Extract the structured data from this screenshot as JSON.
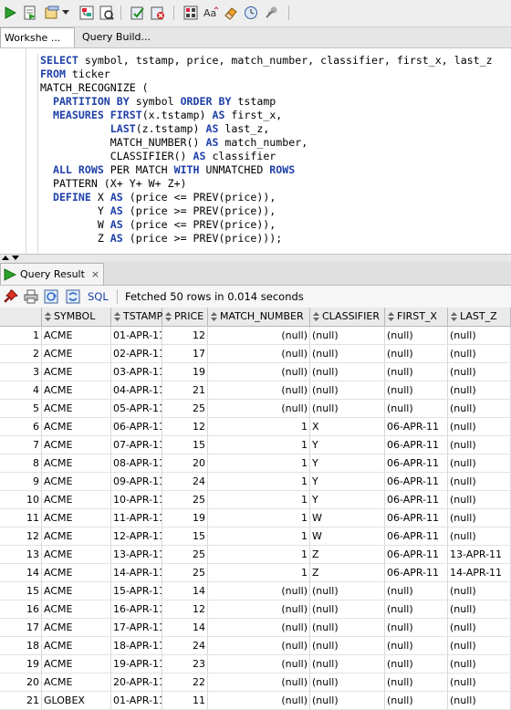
{
  "toolbar": {
    "buttons": [
      "run-statement",
      "run-script",
      "autotrace",
      "explain-plan",
      "sql-tuning",
      "commit",
      "rollback",
      "unshared-sql",
      "to-upper",
      "clear",
      "history",
      "sql-monitor"
    ]
  },
  "worksheet_tabs": [
    {
      "label": "Workshe ..."
    },
    {
      "label": "Query Build..."
    }
  ],
  "editor": {
    "lines": [
      [
        {
          "t": "SELECT",
          "k": 1
        },
        {
          "t": " symbol, tstamp, price, match_number, classifier, first_x, last_z",
          "k": 0
        }
      ],
      [
        {
          "t": "FROM",
          "k": 1
        },
        {
          "t": " ticker",
          "k": 0
        }
      ],
      [
        {
          "t": "MATCH_RECOGNIZE (",
          "k": 0
        }
      ],
      [
        {
          "t": "  ",
          "k": 0
        },
        {
          "t": "PARTITION BY",
          "k": 1
        },
        {
          "t": " symbol ",
          "k": 0
        },
        {
          "t": "ORDER BY",
          "k": 1
        },
        {
          "t": " tstamp",
          "k": 0
        }
      ],
      [
        {
          "t": "  ",
          "k": 0
        },
        {
          "t": "MEASURES FIRST",
          "k": 1
        },
        {
          "t": "(x.tstamp) ",
          "k": 0
        },
        {
          "t": "AS",
          "k": 1
        },
        {
          "t": " first_x,",
          "k": 0
        }
      ],
      [
        {
          "t": "           ",
          "k": 0
        },
        {
          "t": "LAST",
          "k": 1
        },
        {
          "t": "(z.tstamp) ",
          "k": 0
        },
        {
          "t": "AS",
          "k": 1
        },
        {
          "t": " last_z,",
          "k": 0
        }
      ],
      [
        {
          "t": "           MATCH_NUMBER() ",
          "k": 0
        },
        {
          "t": "AS",
          "k": 1
        },
        {
          "t": " match_number,",
          "k": 0
        }
      ],
      [
        {
          "t": "           CLASSIFIER() ",
          "k": 0
        },
        {
          "t": "AS",
          "k": 1
        },
        {
          "t": " classifier",
          "k": 0
        }
      ],
      [
        {
          "t": "  ",
          "k": 0
        },
        {
          "t": "ALL ROWS",
          "k": 1
        },
        {
          "t": " PER MATCH ",
          "k": 0
        },
        {
          "t": "WITH",
          "k": 1
        },
        {
          "t": " UNMATCHED ",
          "k": 0
        },
        {
          "t": "ROWS",
          "k": 1
        }
      ],
      [
        {
          "t": "  PATTERN (X+ Y+ W+ Z+)",
          "k": 0
        }
      ],
      [
        {
          "t": "  ",
          "k": 0
        },
        {
          "t": "DEFINE",
          "k": 1
        },
        {
          "t": " X ",
          "k": 0
        },
        {
          "t": "AS",
          "k": 1
        },
        {
          "t": " (price <= PREV(price)),",
          "k": 0
        }
      ],
      [
        {
          "t": "         Y ",
          "k": 0
        },
        {
          "t": "AS",
          "k": 1
        },
        {
          "t": " (price >= PREV(price)),",
          "k": 0
        }
      ],
      [
        {
          "t": "         W ",
          "k": 0
        },
        {
          "t": "AS",
          "k": 1
        },
        {
          "t": " (price <= PREV(price)),",
          "k": 0
        }
      ],
      [
        {
          "t": "         Z ",
          "k": 0
        },
        {
          "t": "AS",
          "k": 1
        },
        {
          "t": " (price >= PREV(price)));",
          "k": 0
        }
      ]
    ]
  },
  "result_tab": {
    "label": "Query Result",
    "close": "×"
  },
  "result_toolbar": {
    "sql_label": "SQL",
    "status": "Fetched 50 rows in 0.014 seconds"
  },
  "grid": {
    "columns": [
      "SYMBOL",
      "TSTAMP",
      "PRICE",
      "MATCH_NUMBER",
      "CLASSIFIER",
      "FIRST_X",
      "LAST_Z"
    ],
    "rows": [
      [
        "1",
        "ACME",
        "01-APR-11",
        "12",
        "(null)",
        "(null)",
        "(null)",
        "(null)"
      ],
      [
        "2",
        "ACME",
        "02-APR-11",
        "17",
        "(null)",
        "(null)",
        "(null)",
        "(null)"
      ],
      [
        "3",
        "ACME",
        "03-APR-11",
        "19",
        "(null)",
        "(null)",
        "(null)",
        "(null)"
      ],
      [
        "4",
        "ACME",
        "04-APR-11",
        "21",
        "(null)",
        "(null)",
        "(null)",
        "(null)"
      ],
      [
        "5",
        "ACME",
        "05-APR-11",
        "25",
        "(null)",
        "(null)",
        "(null)",
        "(null)"
      ],
      [
        "6",
        "ACME",
        "06-APR-11",
        "12",
        "1",
        "X",
        "06-APR-11",
        "(null)"
      ],
      [
        "7",
        "ACME",
        "07-APR-11",
        "15",
        "1",
        "Y",
        "06-APR-11",
        "(null)"
      ],
      [
        "8",
        "ACME",
        "08-APR-11",
        "20",
        "1",
        "Y",
        "06-APR-11",
        "(null)"
      ],
      [
        "9",
        "ACME",
        "09-APR-11",
        "24",
        "1",
        "Y",
        "06-APR-11",
        "(null)"
      ],
      [
        "10",
        "ACME",
        "10-APR-11",
        "25",
        "1",
        "Y",
        "06-APR-11",
        "(null)"
      ],
      [
        "11",
        "ACME",
        "11-APR-11",
        "19",
        "1",
        "W",
        "06-APR-11",
        "(null)"
      ],
      [
        "12",
        "ACME",
        "12-APR-11",
        "15",
        "1",
        "W",
        "06-APR-11",
        "(null)"
      ],
      [
        "13",
        "ACME",
        "13-APR-11",
        "25",
        "1",
        "Z",
        "06-APR-11",
        "13-APR-11"
      ],
      [
        "14",
        "ACME",
        "14-APR-11",
        "25",
        "1",
        "Z",
        "06-APR-11",
        "14-APR-11"
      ],
      [
        "15",
        "ACME",
        "15-APR-11",
        "14",
        "(null)",
        "(null)",
        "(null)",
        "(null)"
      ],
      [
        "16",
        "ACME",
        "16-APR-11",
        "12",
        "(null)",
        "(null)",
        "(null)",
        "(null)"
      ],
      [
        "17",
        "ACME",
        "17-APR-11",
        "14",
        "(null)",
        "(null)",
        "(null)",
        "(null)"
      ],
      [
        "18",
        "ACME",
        "18-APR-11",
        "24",
        "(null)",
        "(null)",
        "(null)",
        "(null)"
      ],
      [
        "19",
        "ACME",
        "19-APR-11",
        "23",
        "(null)",
        "(null)",
        "(null)",
        "(null)"
      ],
      [
        "20",
        "ACME",
        "20-APR-11",
        "22",
        "(null)",
        "(null)",
        "(null)",
        "(null)"
      ],
      [
        "21",
        "GLOBEX",
        "01-APR-11",
        "11",
        "(null)",
        "(null)",
        "(null)",
        "(null)"
      ]
    ]
  }
}
